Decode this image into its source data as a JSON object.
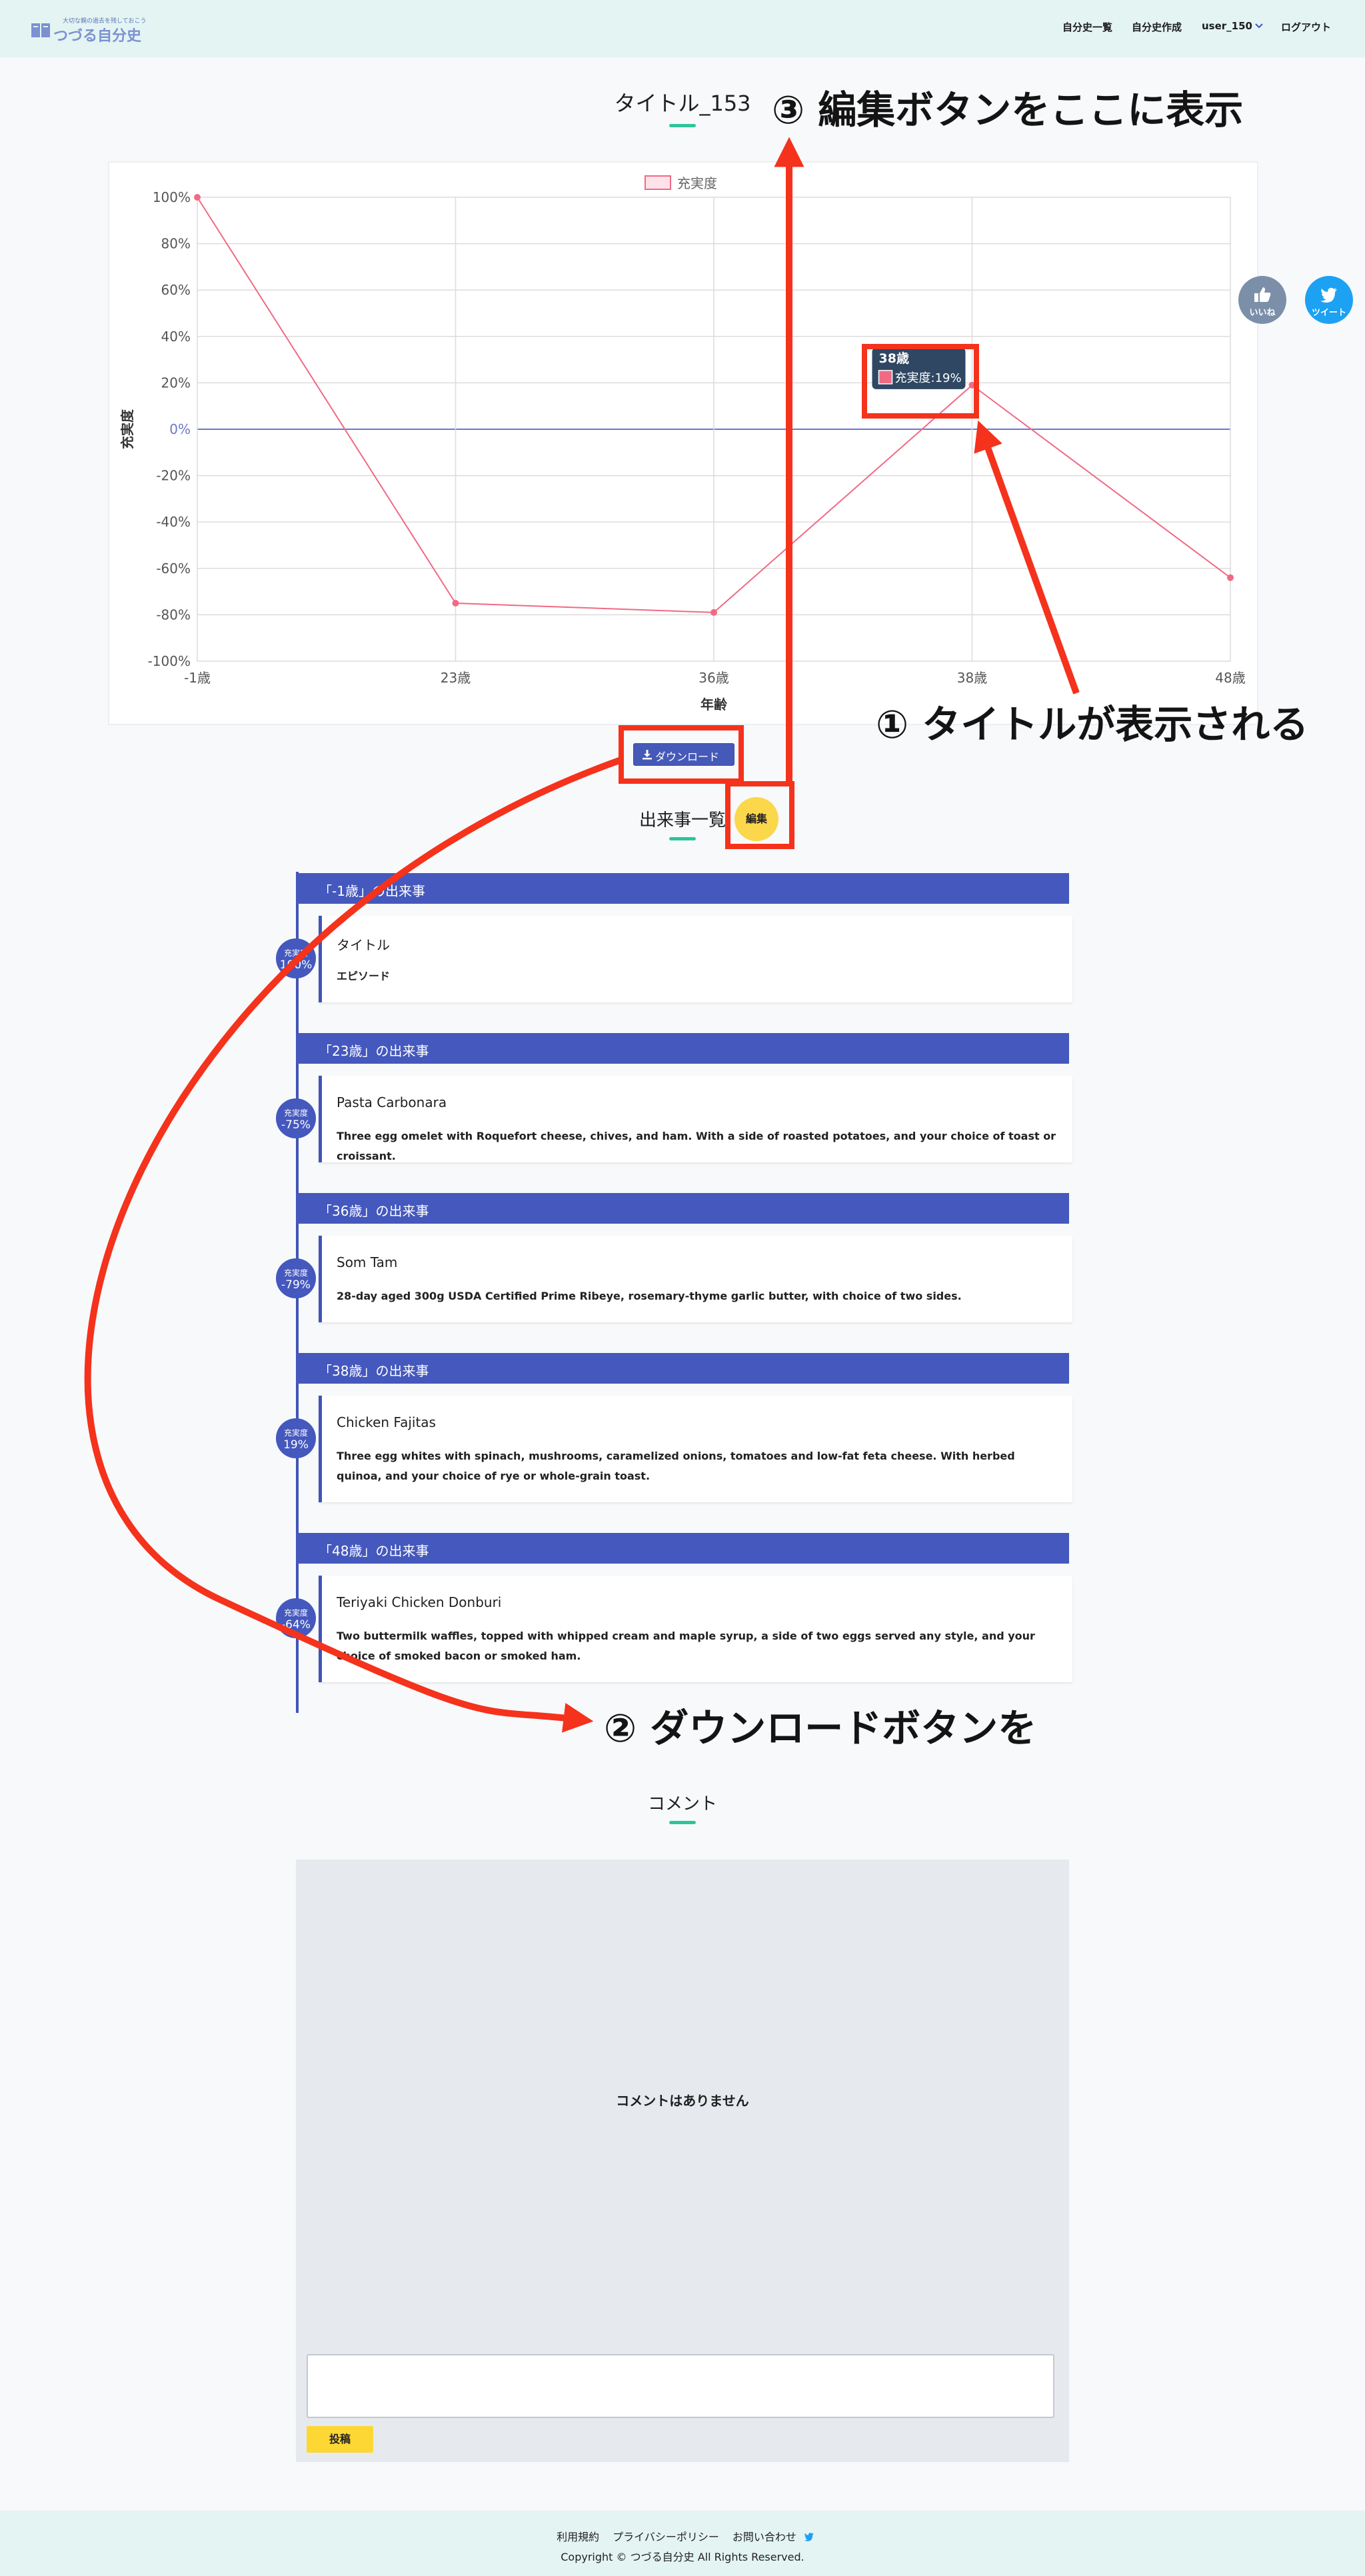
{
  "header": {
    "logo_tagline": "大切な親の過去を残しておこう",
    "logo_name": "つづる自分史",
    "nav": {
      "list": "自分史一覧",
      "create": "自分史作成",
      "user": "user_150",
      "logout": "ログアウト"
    }
  },
  "page": {
    "title": "タイトル_153",
    "download_label": "ダウンロード",
    "events_heading": "出来事一覧",
    "edit_label": "編集",
    "like_label": "いいね",
    "tweet_label": "ツイート",
    "comments_heading": "コメント",
    "no_comments": "コメントはありません",
    "post_label": "投稿"
  },
  "annotations": {
    "a1": "① タイトルが表示される",
    "a2": "② ダウンロードボタンを",
    "a3": "③ 編集ボタンをここに表示"
  },
  "chart_data": {
    "type": "line",
    "legend": "充実度",
    "legend_position": "top",
    "ylabel": "充実度",
    "xlabel": "年齢",
    "x": [
      "-1歳",
      "23歳",
      "36歳",
      "38歳",
      "48歳"
    ],
    "series": [
      {
        "name": "充実度",
        "values": [
          100,
          -75,
          -79,
          19,
          -64
        ]
      }
    ],
    "ylim": [
      -100,
      100
    ],
    "yticks": [
      100,
      80,
      60,
      40,
      20,
      0,
      -20,
      -40,
      -60,
      -80,
      -100
    ],
    "grid": true,
    "colors": {
      "line": "#f06a84",
      "zero": "#6b78c8"
    },
    "tooltip": {
      "title": "38歳",
      "label": "充実度:19%"
    }
  },
  "events": [
    {
      "header": "「-1歳」の出来事",
      "title": "タイトル",
      "desc": "エピソード",
      "badge_label": "充実度",
      "badge_value": "100%"
    },
    {
      "header": "「23歳」の出来事",
      "title": "Pasta Carbonara",
      "desc": "Three egg omelet with Roquefort cheese, chives, and ham. With a side of roasted potatoes, and your choice of toast or croissant.",
      "badge_label": "充実度",
      "badge_value": "-75%"
    },
    {
      "header": "「36歳」の出来事",
      "title": "Som Tam",
      "desc": "28-day aged 300g USDA Certified Prime Ribeye, rosemary-thyme garlic butter, with choice of two sides.",
      "badge_label": "充実度",
      "badge_value": "-79%"
    },
    {
      "header": "「38歳」の出来事",
      "title": "Chicken Fajitas",
      "desc": "Three egg whites with spinach, mushrooms, caramelized onions, tomatoes and low-fat feta cheese. With herbed quinoa, and your choice of rye or whole-grain toast.",
      "badge_label": "充実度",
      "badge_value": "19%"
    },
    {
      "header": "「48歳」の出来事",
      "title": "Teriyaki Chicken Donburi",
      "desc": "Two buttermilk waffles, topped with whipped cream and maple syrup, a side of two eggs served any style, and your choice of smoked bacon or smoked ham.",
      "badge_label": "充実度",
      "badge_value": "-64%"
    }
  ],
  "footer": {
    "terms": "利用規約",
    "privacy": "プライバシーポリシー",
    "contact": "お問い合わせ",
    "copyright": "Copyright © つづる自分史 All Rights Reserved."
  }
}
